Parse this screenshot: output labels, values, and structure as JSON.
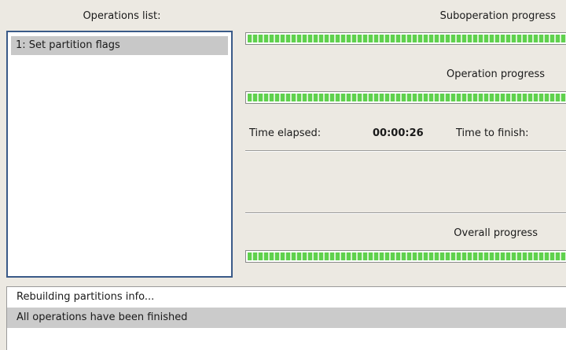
{
  "operations": {
    "header": "Operations list:",
    "items": [
      "1: Set partition flags"
    ]
  },
  "progress": {
    "suboperation_label": "Suboperation progress",
    "suboperation_value": 1.0,
    "operation_label": "Operation progress",
    "operation_value": 1.0,
    "overall_label": "Overall progress",
    "overall_value": 1.0
  },
  "timing": {
    "elapsed_label": "Time elapsed:",
    "elapsed_value": "00:00:26",
    "finish_label": "Time to finish:"
  },
  "log": {
    "lines": [
      "Rebuilding partitions info...",
      "All operations have been finished"
    ],
    "selected_index": 1
  },
  "colors": {
    "progress_fill": "#5fd14d",
    "list_border": "#3a5a88",
    "selection_bg": "#c8c8c8"
  }
}
